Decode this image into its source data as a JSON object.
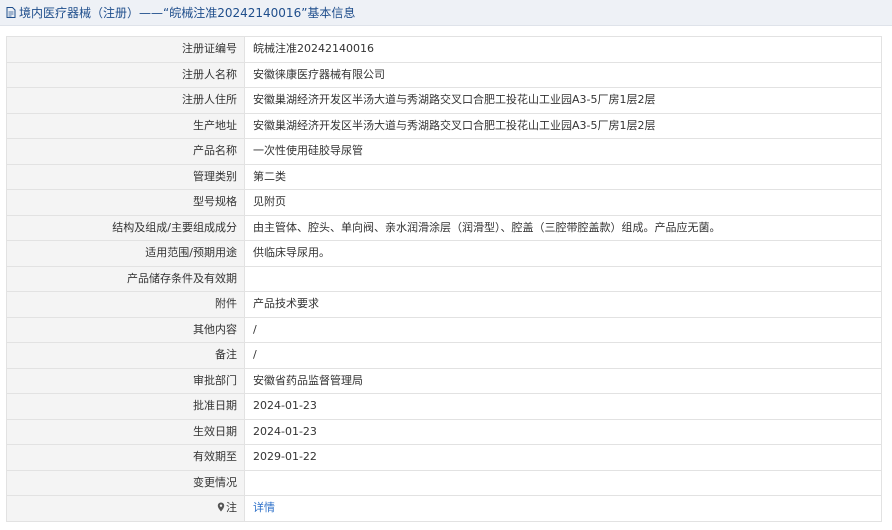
{
  "header": {
    "title": "境内医疗器械（注册）——“皖械注准20242140016”基本信息",
    "icon": "document-icon"
  },
  "rows": [
    {
      "label": "注册证编号",
      "value": "皖械注准20242140016"
    },
    {
      "label": "注册人名称",
      "value": "安徽徕康医疗器械有限公司"
    },
    {
      "label": "注册人住所",
      "value": "安徽巢湖经济开发区半汤大道与秀湖路交叉口合肥工投花山工业园A3-5厂房1层2层"
    },
    {
      "label": "生产地址",
      "value": "安徽巢湖经济开发区半汤大道与秀湖路交叉口合肥工投花山工业园A3-5厂房1层2层"
    },
    {
      "label": "产品名称",
      "value": "一次性使用硅胶导尿管"
    },
    {
      "label": "管理类别",
      "value": "第二类"
    },
    {
      "label": "型号规格",
      "value": "见附页"
    },
    {
      "label": "结构及组成/主要组成成分",
      "value": "由主管体、腔头、单向阀、亲水润滑涂层（润滑型）、腔盖（三腔带腔盖款）组成。产品应无菌。"
    },
    {
      "label": "适用范围/预期用途",
      "value": "供临床导尿用。"
    },
    {
      "label": "产品储存条件及有效期",
      "value": ""
    },
    {
      "label": "附件",
      "value": "产品技术要求"
    },
    {
      "label": "其他内容",
      "value": "/"
    },
    {
      "label": "备注",
      "value": "/"
    },
    {
      "label": "审批部门",
      "value": "安徽省药品监督管理局"
    },
    {
      "label": "批准日期",
      "value": "2024-01-23"
    },
    {
      "label": "生效日期",
      "value": "2024-01-23"
    },
    {
      "label": "有效期至",
      "value": "2029-01-22"
    },
    {
      "label": "变更情况",
      "value": ""
    }
  ],
  "note_row": {
    "icon": "pin-icon",
    "label": "注",
    "link_text": "详情"
  },
  "colors": {
    "header_text": "#1f4e8c",
    "link": "#2a6ec8",
    "label_bg": "#f4f4f4"
  }
}
